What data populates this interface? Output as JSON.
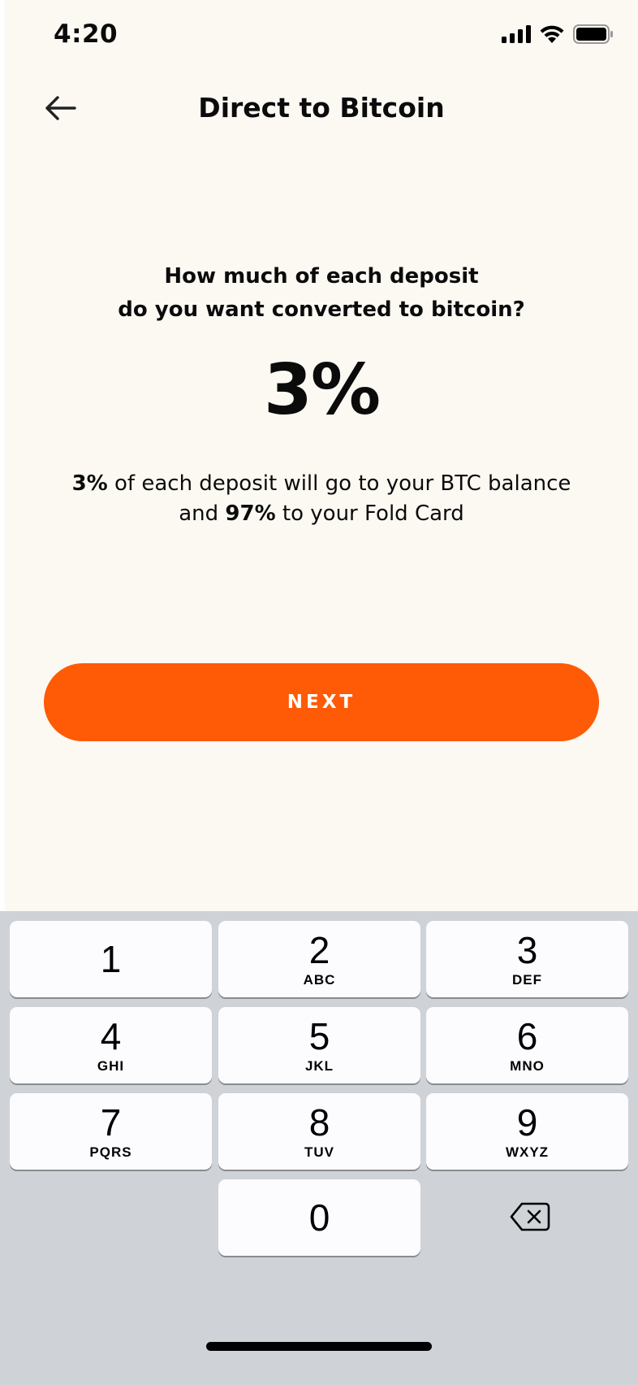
{
  "status_bar": {
    "time": "4:20",
    "icons": [
      "cellular-signal-icon",
      "wifi-icon",
      "battery-icon"
    ]
  },
  "header": {
    "title": "Direct to Bitcoin",
    "back_icon": "arrow-left-icon"
  },
  "main": {
    "question_line1": "How much of each deposit",
    "question_line2": "do you want converted to bitcoin?",
    "percent_value": "3%",
    "explain": {
      "btc_percent": "3%",
      "line1_rest": " of each deposit will go to your BTC balance",
      "line2_prefix": "and ",
      "card_percent": "97%",
      "line2_rest": " to your Fold Card"
    },
    "next_label": "NEXT"
  },
  "keypad": {
    "keys": [
      {
        "digit": "1",
        "letters": ""
      },
      {
        "digit": "2",
        "letters": "ABC"
      },
      {
        "digit": "3",
        "letters": "DEF"
      },
      {
        "digit": "4",
        "letters": "GHI"
      },
      {
        "digit": "5",
        "letters": "JKL"
      },
      {
        "digit": "6",
        "letters": "MNO"
      },
      {
        "digit": "7",
        "letters": "PQRS"
      },
      {
        "digit": "8",
        "letters": "TUV"
      },
      {
        "digit": "9",
        "letters": "WXYZ"
      },
      {
        "digit": "0",
        "letters": ""
      }
    ],
    "delete_icon": "backspace-icon"
  },
  "colors": {
    "accent": "#ff5a06",
    "background": "#fcf9f3",
    "keyboard_bg": "#cfd2d6"
  }
}
